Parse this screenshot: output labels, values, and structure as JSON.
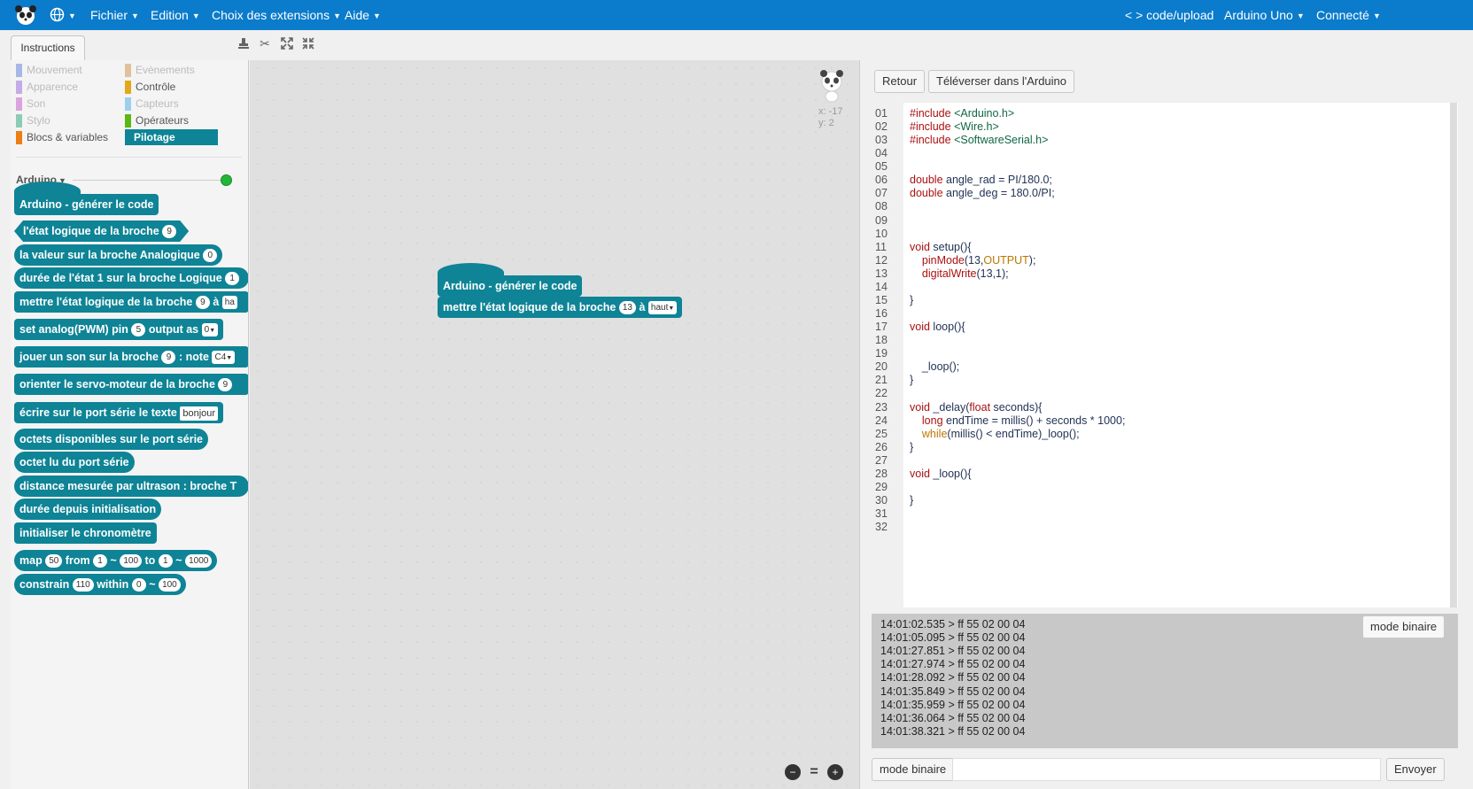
{
  "menubar": {
    "file": "Fichier",
    "edit": "Edition",
    "extensions": "Choix des extensions",
    "help": "Aide",
    "code_upload": "< > code/upload",
    "board": "Arduino Uno",
    "connection": "Connecté"
  },
  "tabs": {
    "instructions": "Instructions"
  },
  "categories": {
    "left": [
      "Mouvement",
      "Apparence",
      "Son",
      "Stylo",
      "Blocs & variables"
    ],
    "right": [
      "Evènements",
      "Contrôle",
      "Capteurs",
      "Opérateurs",
      "Pilotage"
    ]
  },
  "colors": {
    "accent": "#0b7bcb",
    "block": "#0e8496",
    "connected": "#4cd964",
    "mouvement": "#4a6cd4",
    "apparence": "#8a55d7",
    "son": "#bb42c3",
    "stylo": "#0e9a6c",
    "blocs": "#ee7d16",
    "evenements": "#c88330",
    "controle": "#e1a91a",
    "capteurs": "#2ca5e2",
    "operateurs": "#5cb712",
    "pilotage": "#0e8496"
  },
  "palette": {
    "section": "Arduino",
    "blocks": {
      "b1": "Arduino - générer le code",
      "b2_a": "l'état logique de la broche",
      "b2_v": "9",
      "b3_a": "la valeur sur la broche Analogique",
      "b3_v": "0",
      "b4_a": "durée de l'état 1 sur la broche Logique",
      "b4_v": "1",
      "b5_a": "mettre l'état logique de la broche",
      "b5_v": "9",
      "b5_b": "à",
      "b5_c": "ha",
      "b6_a": "set analog(PWM) pin",
      "b6_v": "5",
      "b6_b": "output as",
      "b6_c": "0",
      "b7_a": "jouer un son sur la broche",
      "b7_v": "9",
      "b7_b": ": note",
      "b7_c": "C4",
      "b8_a": "orienter le servo-moteur de la broche",
      "b8_v": "9",
      "b9_a": "écrire sur le port série le texte",
      "b9_v": "bonjour",
      "b10": "octets disponibles sur le port série",
      "b11": "octet lu du port série",
      "b12": "distance mesurée par ultrason : broche T",
      "b13": "durée depuis initialisation",
      "b14": "initialiser le chronomètre",
      "b15_a": "map",
      "b15_v1": "50",
      "b15_b": "from",
      "b15_v2": "1",
      "b15_t1": "~",
      "b15_v3": "100",
      "b15_c": "to",
      "b15_v4": "1",
      "b15_t2": "~",
      "b15_v5": "1000",
      "b16_a": "constrain",
      "b16_v1": "110",
      "b16_b": "within",
      "b16_v2": "0",
      "b16_t": "~",
      "b16_v3": "100"
    }
  },
  "workspace": {
    "coord_x": "x: -17",
    "coord_y": "y: 2",
    "hat": "Arduino - générer le code",
    "cmd_a": "mettre l'état logique de la broche",
    "cmd_v": "13",
    "cmd_b": "à",
    "cmd_c": "haut"
  },
  "code": {
    "back_button": "Retour",
    "upload_button": "Téléverser dans l'Arduino",
    "line_numbers": [
      "01",
      "02",
      "03",
      "04",
      "05",
      "06",
      "07",
      "08",
      "09",
      "10",
      "11",
      "12",
      "13",
      "14",
      "15",
      "16",
      "17",
      "18",
      "19",
      "20",
      "21",
      "22",
      "23",
      "24",
      "25",
      "26",
      "27",
      "28",
      "29",
      "30",
      "31",
      "32"
    ],
    "lines": [
      "#include <Arduino.h>",
      "#include <Wire.h>",
      "#include <SoftwareSerial.h>",
      "",
      "",
      "double angle_rad = PI/180.0;",
      "double angle_deg = 180.0/PI;",
      "",
      "",
      "",
      "void setup(){",
      "    pinMode(13,OUTPUT);",
      "    digitalWrite(13,1);",
      "",
      "}",
      "",
      "void loop(){",
      "",
      "",
      "    _loop();",
      "}",
      "",
      "void _delay(float seconds){",
      "    long endTime = millis() + seconds * 1000;",
      "    while(millis() < endTime)_loop();",
      "}",
      "",
      "void _loop(){",
      "",
      "}",
      "",
      ""
    ]
  },
  "serial": {
    "log": [
      "14:01:02.535 > ff 55 02 00 04",
      "14:01:05.095 > ff 55 02 00 04",
      "14:01:27.851 > ff 55 02 00 04",
      "14:01:27.974 > ff 55 02 00 04",
      "14:01:28.092 > ff 55 02 00 04",
      "14:01:35.849 > ff 55 02 00 04",
      "14:01:35.959 > ff 55 02 00 04",
      "14:01:36.064 > ff 55 02 00 04",
      "14:01:38.321 > ff 55 02 00 04"
    ],
    "binary_mode_top": "mode binaire",
    "binary_mode_bottom": "mode binaire",
    "send_button": "Envoyer",
    "input_value": ""
  }
}
